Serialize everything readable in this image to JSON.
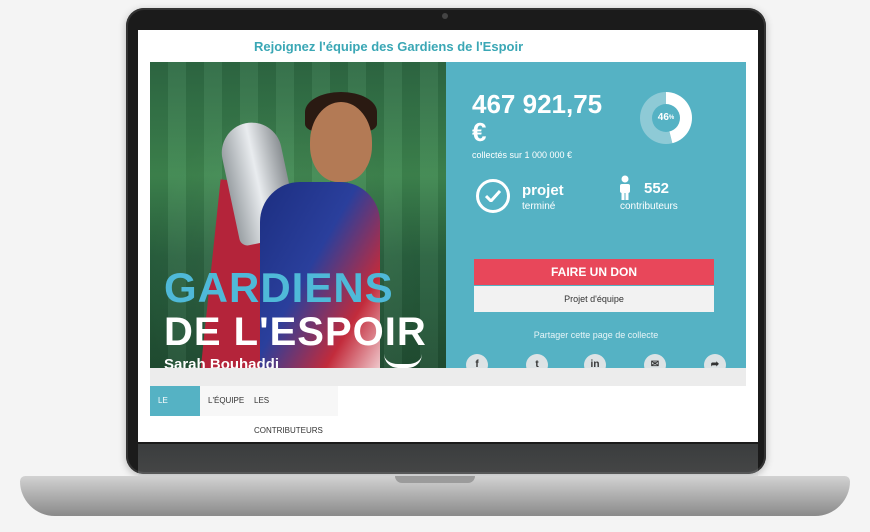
{
  "page": {
    "title": "Rejoignez l'équipe des Gardiens de l'Espoir"
  },
  "hero": {
    "title_line1": "GARDIENS",
    "title_line2": "DE L'ESPOIR",
    "subtitle": "Sarah Bouhaddi"
  },
  "stats": {
    "amount": "467 921,75 €",
    "amount_sub": "collectés sur 1 000 000 €",
    "progress_label": "46",
    "progress_fraction": 0.46,
    "status": "projet",
    "status_sub": "terminé",
    "contributors_count": "552",
    "contributors_label": "contributeurs"
  },
  "actions": {
    "donate_label": "FAIRE UN DON",
    "team_label": "Projet d'équipe",
    "share_label": "Partager cette page de collecte"
  },
  "share_buttons": [
    {
      "icon": "facebook-icon",
      "glyph": "f"
    },
    {
      "icon": "twitter-icon",
      "glyph": "t"
    },
    {
      "icon": "linkedin-icon",
      "glyph": "in"
    },
    {
      "icon": "email-icon",
      "glyph": "✉"
    },
    {
      "icon": "share-arrow-icon",
      "glyph": "➦"
    }
  ],
  "tabs": [
    {
      "label": "LE PROJET",
      "active": true
    },
    {
      "label": "L'ÉQUIPE",
      "active": false
    },
    {
      "label": "LES CONTRIBUTEURS",
      "active": false
    }
  ],
  "colors": {
    "accent": "#55b2c4",
    "donate": "#e8475a",
    "title": "#3aa7b5"
  }
}
